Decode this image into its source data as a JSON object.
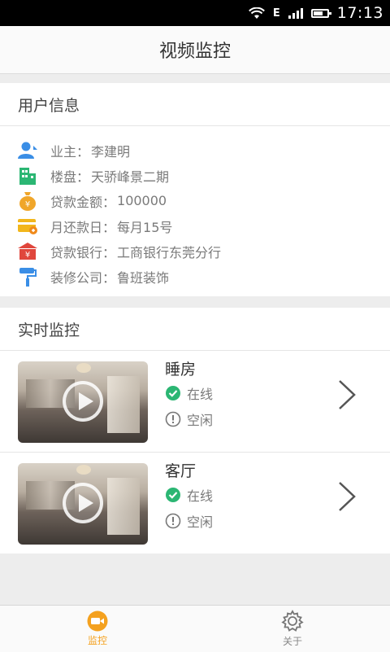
{
  "status_bar": {
    "time": "17:13",
    "network": "E"
  },
  "header": {
    "title": "视频监控"
  },
  "user_info": {
    "section_title": "用户信息",
    "rows": [
      {
        "label": "业主：",
        "value": "李建明",
        "icon": "owner-icon",
        "color": "#3a8ee6"
      },
      {
        "label": "楼盘：",
        "value": "天骄峰景二期",
        "icon": "building-icon",
        "color": "#2bb673"
      },
      {
        "label": "贷款金额：",
        "value": "100000",
        "icon": "money-bag-icon",
        "color": "#f0a62a"
      },
      {
        "label": "月还款日：",
        "value": "每月15号",
        "icon": "card-icon",
        "color": "#f2b61b"
      },
      {
        "label": "贷款银行：",
        "value": "工商银行东莞分行",
        "icon": "bank-icon",
        "color": "#e0463c"
      },
      {
        "label": "装修公司：",
        "value": "鲁班装饰",
        "icon": "paint-roller-icon",
        "color": "#3a8ee6"
      }
    ]
  },
  "monitor": {
    "section_title": "实时监控",
    "cameras": [
      {
        "name": "睡房",
        "online": "在线",
        "state": "空闲"
      },
      {
        "name": "客厅",
        "online": "在线",
        "state": "空闲"
      }
    ]
  },
  "bottom_nav": {
    "items": [
      {
        "label": "监控",
        "icon": "camera-icon",
        "active": true
      },
      {
        "label": "关于",
        "icon": "gear-icon",
        "active": false
      }
    ],
    "accent": "#f4a11f"
  }
}
